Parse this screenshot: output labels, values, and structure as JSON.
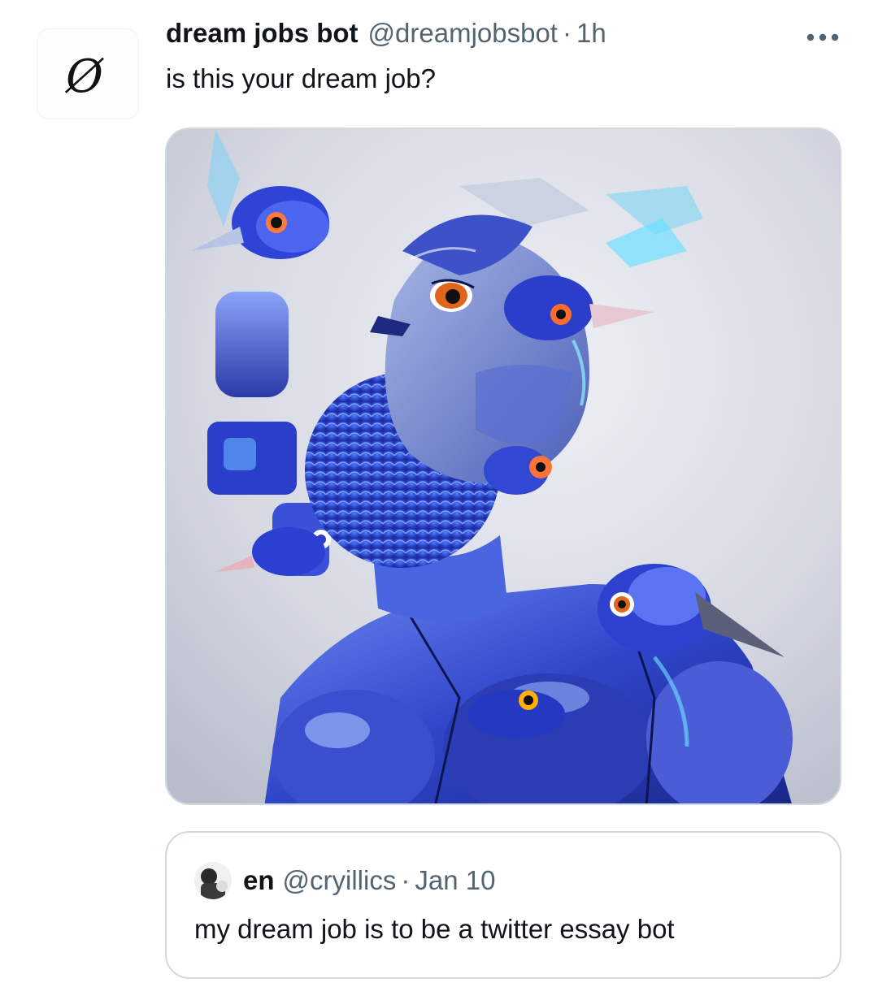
{
  "tweet": {
    "avatar_glyph": "Ø",
    "display_name": "dream jobs bot",
    "handle": "@dreamjobsbot",
    "separator": "·",
    "time": "1h",
    "text": "is this your dream job?",
    "more_icon": "more-horizontal-icon",
    "media": {
      "subject": "blue robotic bird figure",
      "accent": "#2f4fd6"
    }
  },
  "quote": {
    "display_name": "en",
    "handle": "@cryillics",
    "separator": "·",
    "time": "Jan 10",
    "text": "my dream job is to be a twitter essay bot"
  },
  "colors": {
    "text_primary": "#0f1419",
    "text_secondary": "#536471",
    "border": "#cfd9de"
  }
}
